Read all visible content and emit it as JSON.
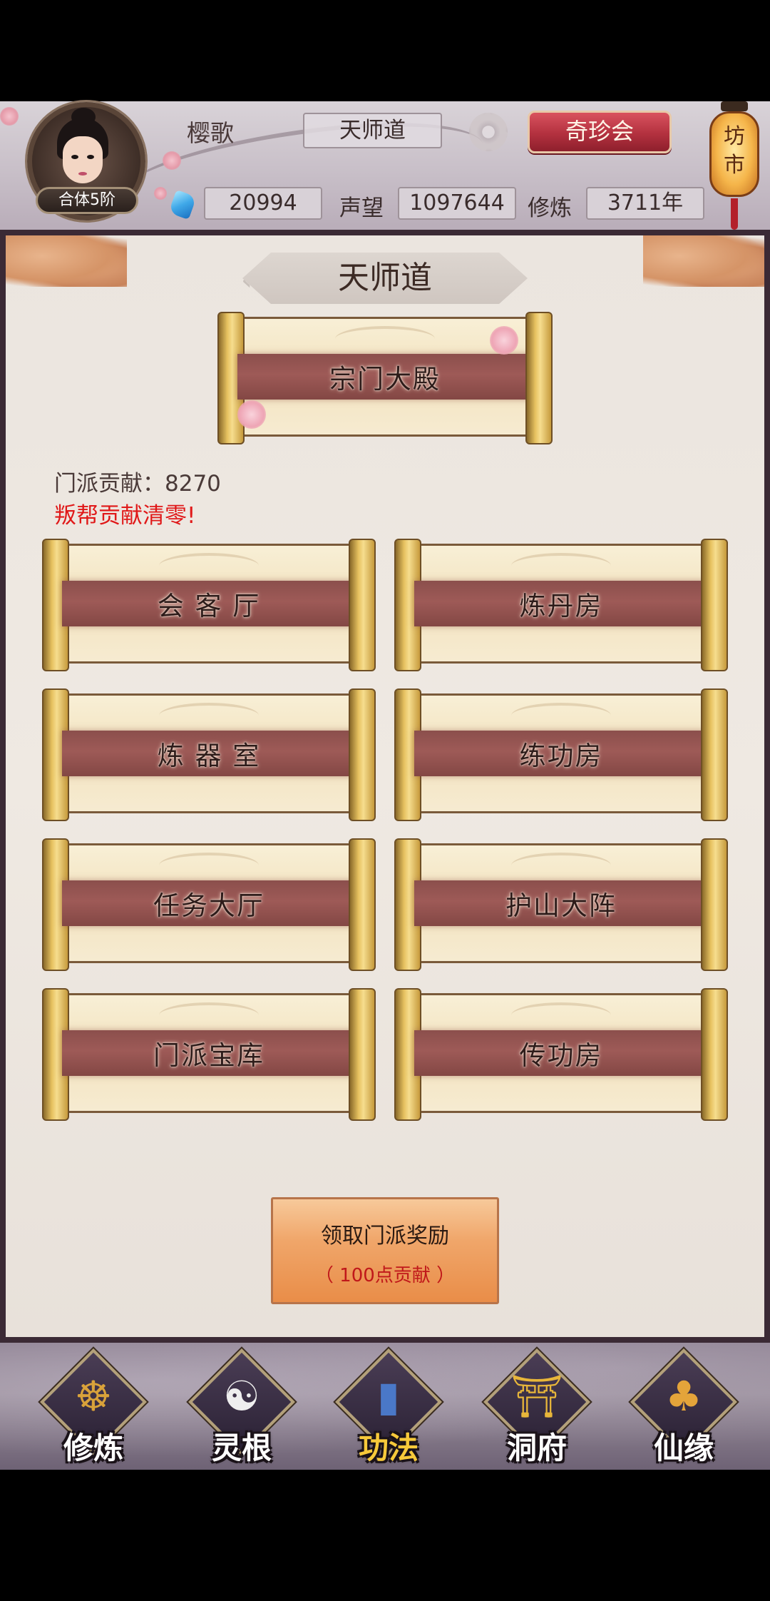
{
  "header": {
    "player_name": "樱歌",
    "level": "合体5阶",
    "sect": "天师道",
    "treasure_button": "奇珍会",
    "lantern_text": "坊\n市",
    "spirit_stones": "20994",
    "reputation_label": "声望",
    "reputation": "1097644",
    "cultivation_label": "修炼",
    "cultivation": "3711年"
  },
  "panel": {
    "title": "天师道",
    "main_hall": "宗门大殿",
    "contribution": "门派贡献：8270",
    "warning": "叛帮贡献清零!",
    "buildings": [
      {
        "label": "会 客 厅"
      },
      {
        "label": "炼丹房"
      },
      {
        "label": "炼 器 室"
      },
      {
        "label": "练功房"
      },
      {
        "label": "任务大厅"
      },
      {
        "label": "护山大阵"
      },
      {
        "label": "门派宝库"
      },
      {
        "label": "传功房"
      }
    ],
    "reward_button": {
      "title": "领取门派奖励",
      "subtitle": "（ 100点贡献 ）"
    }
  },
  "nav": [
    {
      "label": "修炼",
      "icon": "monk-icon",
      "active": false
    },
    {
      "label": "灵根",
      "icon": "yin-yang-sword-icon",
      "active": false
    },
    {
      "label": "功法",
      "icon": "scripture-book-icon",
      "active": true
    },
    {
      "label": "洞府",
      "icon": "pagoda-icon",
      "active": false
    },
    {
      "label": "仙缘",
      "icon": "gourd-icon",
      "active": false
    }
  ],
  "colors": {
    "warning": "#e01818",
    "active_nav": "#f7c93a",
    "scroll_band": "#8b4f4c",
    "reward_button": "#f0a66a"
  }
}
